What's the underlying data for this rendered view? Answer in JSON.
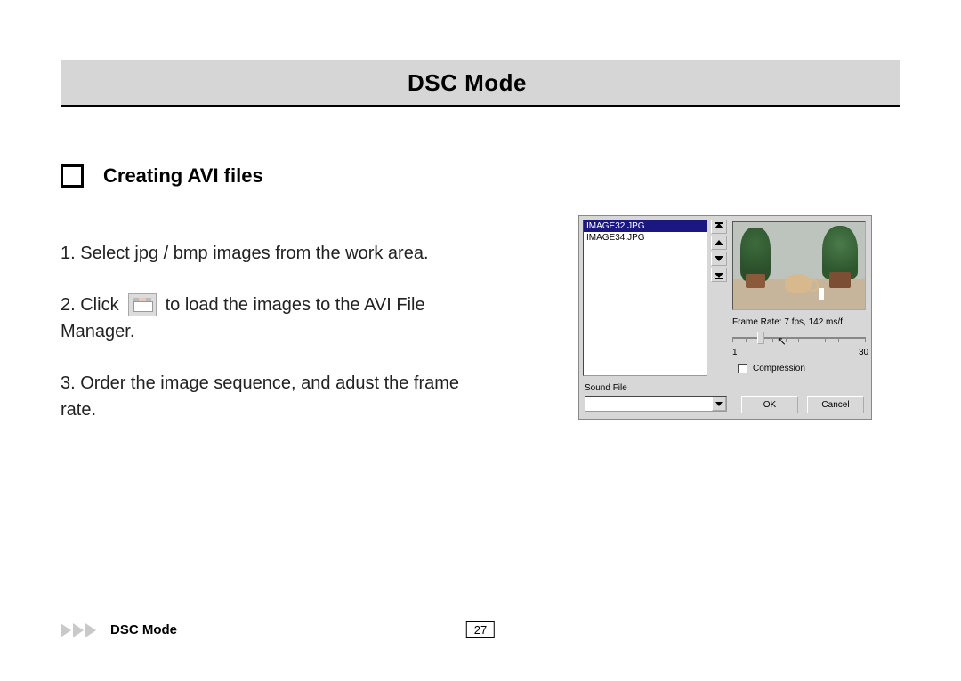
{
  "heading": "DSC Mode",
  "section_title": "Creating AVI files",
  "steps": {
    "s1": "1. Select jpg / bmp images from the work area.",
    "s2_pre": "2. Click",
    "s2_post": "to load the images to the AVI File",
    "s2_line2": "Manager.",
    "s3_line1": "3. Order the image sequence, and adust the frame",
    "s3_line2": "rate."
  },
  "dialog": {
    "list_items": [
      "IMAGE32.JPG",
      "IMAGE34.JPG"
    ],
    "frame_rate_label": "Frame Rate: 7 fps, 142 ms/f",
    "slider_min": "1",
    "slider_max": "30",
    "compression_label": "Compression",
    "sound_file_label": "Sound File",
    "ok_label": "OK",
    "cancel_label": "Cancel"
  },
  "footer": {
    "title": "DSC Mode",
    "page_number": "27"
  }
}
